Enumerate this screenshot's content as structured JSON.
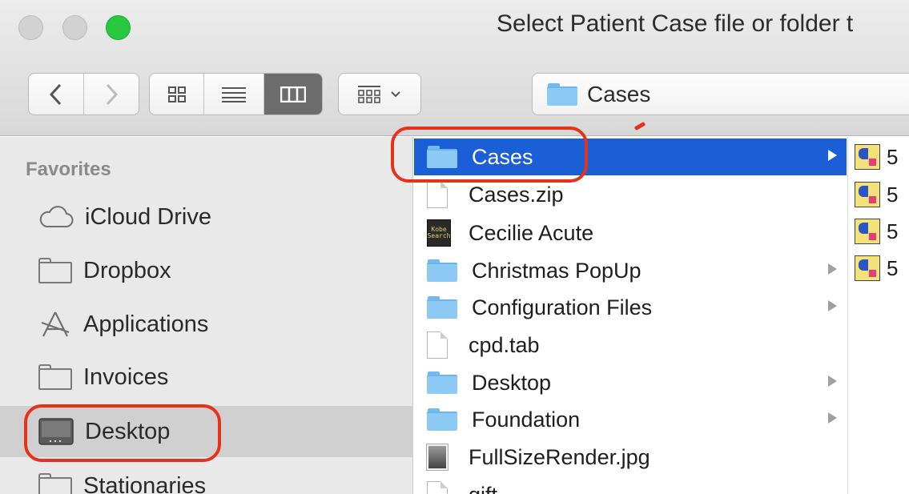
{
  "window": {
    "title": "Select Patient Case file or folder t"
  },
  "toolbar": {
    "view_modes": [
      "icon-view",
      "list-view",
      "column-view"
    ],
    "selected_view": "column-view",
    "path_folder": "Cases"
  },
  "sidebar": {
    "header": "Favorites",
    "items": [
      {
        "label": "iCloud Drive",
        "icon": "cloud-icon"
      },
      {
        "label": "Dropbox",
        "icon": "folder-icon"
      },
      {
        "label": "Applications",
        "icon": "applications-icon"
      },
      {
        "label": "Invoices",
        "icon": "folder-icon"
      },
      {
        "label": "Desktop",
        "icon": "desktop-icon",
        "selected": true
      },
      {
        "label": "Stationaries",
        "icon": "folder-icon"
      }
    ]
  },
  "column1": {
    "items": [
      {
        "label": "Cases",
        "kind": "folder",
        "has_children": true,
        "selected": true
      },
      {
        "label": "Cases.zip",
        "kind": "zip",
        "has_children": false
      },
      {
        "label": "Cecilie Acute",
        "kind": "app",
        "has_children": false
      },
      {
        "label": "Christmas PopUp",
        "kind": "folder",
        "has_children": true
      },
      {
        "label": "Configuration Files",
        "kind": "folder",
        "has_children": true
      },
      {
        "label": "cpd.tab",
        "kind": "document",
        "has_children": false
      },
      {
        "label": "Desktop",
        "kind": "folder",
        "has_children": true
      },
      {
        "label": "Foundation",
        "kind": "folder",
        "has_children": true
      },
      {
        "label": "FullSizeRender.jpg",
        "kind": "image",
        "has_children": false
      },
      {
        "label": "gift",
        "kind": "document",
        "has_children": false
      }
    ]
  },
  "column2": {
    "items": [
      {
        "label": "5"
      },
      {
        "label": "5"
      },
      {
        "label": "5"
      },
      {
        "label": "5"
      }
    ]
  },
  "app_icon_text": "Kobe Search",
  "colors": {
    "selection": "#1a5fd6",
    "annotation": "#e8311a",
    "folder": "#8ccaf5",
    "close_button": "#d2d2d2",
    "zoom_button": "#27c840"
  }
}
